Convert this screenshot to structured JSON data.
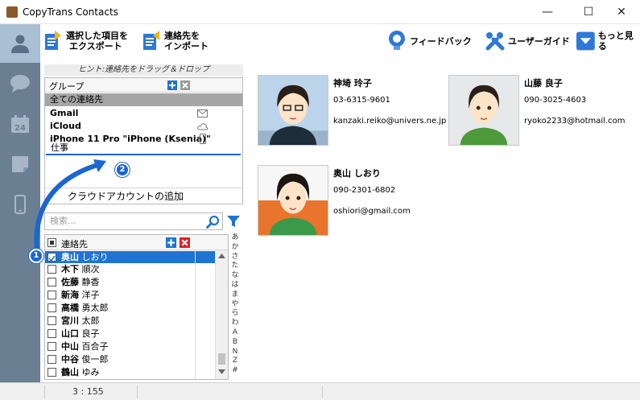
{
  "window": {
    "title": "CopyTrans Contacts",
    "minimize": "—",
    "maximize": "☐",
    "close": "✕"
  },
  "nav": [
    {
      "icon": "person-icon",
      "active": true
    },
    {
      "icon": "chat-bubble-icon",
      "active": false
    },
    {
      "icon": "calendar-icon",
      "active": false,
      "day": "24"
    },
    {
      "icon": "note-icon",
      "active": false
    },
    {
      "icon": "phone-icon",
      "active": false
    }
  ],
  "toolbar": {
    "export_label_1": "選択した項目を",
    "export_label_2": "エクスポート",
    "import_label_1": "連絡先を",
    "import_label_2": "インポート",
    "feedback_label": "フィードバック",
    "guide_label": "ユーザーガイド",
    "more_label": "もっと見る"
  },
  "hint": "ヒント:連絡先をドラッグ＆ドロップ",
  "groups": {
    "header": "グループ",
    "items": [
      {
        "label": "全ての連絡先",
        "selected": true
      },
      {
        "label": "Gmail",
        "bold": true,
        "icon": "gmail-icon"
      },
      {
        "label": "iCloud",
        "bold": true,
        "icon": "cloud-icon"
      },
      {
        "label": "iPhone 11 Pro \"iPhone (Ksenia)\"",
        "bold": true,
        "icon": "phone-icon"
      }
    ],
    "editing_value": "仕事",
    "add_account": "クラウドアカウントの追加"
  },
  "search": {
    "placeholder": "検索..."
  },
  "contacts": {
    "header": "連絡先",
    "rows": [
      {
        "last": "奥山",
        "first": "しおり",
        "checked": true,
        "selected": true
      },
      {
        "last": "木下",
        "first": "順次"
      },
      {
        "last": "佐藤",
        "first": "静香"
      },
      {
        "last": "新海",
        "first": "洋子"
      },
      {
        "last": "高橋",
        "first": "勇太郎"
      },
      {
        "last": "宮川",
        "first": "太郎"
      },
      {
        "last": "山口",
        "first": "良子"
      },
      {
        "last": "中山",
        "first": "百合子"
      },
      {
        "last": "中谷",
        "first": "俊一郎"
      },
      {
        "last": "鶴山",
        "first": "ゆみ"
      }
    ]
  },
  "alphabet": [
    "あ",
    "か",
    "さ",
    "た",
    "な",
    "は",
    "ま",
    "や",
    "ら",
    "わ",
    "A",
    "B",
    "N",
    "Z",
    "#"
  ],
  "cards": [
    {
      "name": "神埼 玲子",
      "phone": "03-6315-9601",
      "email": "kanzaki.reiko@univers.ne.jp"
    },
    {
      "name": "山藤 良子",
      "phone": "090-3025-4603",
      "email": "ryoko2233@hotmail.com"
    },
    {
      "name": "奥山 しおり",
      "phone": "090-2301-6802",
      "email": "oshiori@gmail.com"
    }
  ],
  "status": {
    "count": "3 : 155"
  },
  "annotations": {
    "step1": "1",
    "step2": "2"
  },
  "colors": {
    "accent": "#1f74d1",
    "nav": "#6b7f93",
    "nav_active": "#a9bfd4"
  }
}
